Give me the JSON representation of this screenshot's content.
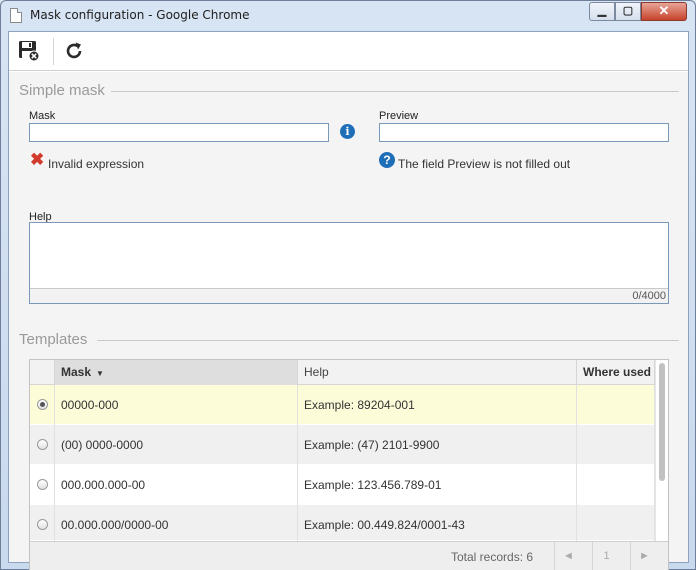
{
  "window": {
    "title": "Mask configuration - Google Chrome"
  },
  "icons": {
    "page": "page-icon",
    "save": "save-close-icon",
    "refresh": "refresh-icon",
    "info": "info-icon",
    "error": "x-icon",
    "help": "question-icon"
  },
  "colors": {
    "error": "#d23b2b",
    "info": "#1f6fb8",
    "selected_row": "#fdfcd9"
  },
  "simple_mask": {
    "section_title": "Simple mask",
    "mask_label": "Mask",
    "mask_value": "",
    "preview_label": "Preview",
    "preview_value": "",
    "error_text": "Invalid expression",
    "preview_status": "The field Preview is not filled out",
    "help_label": "Help",
    "help_value": "",
    "counter": "0/4000"
  },
  "templates": {
    "section_title": "Templates",
    "columns": {
      "mask": "Mask",
      "help": "Help",
      "where_used": "Where used"
    },
    "rows": [
      {
        "mask": "00000-000",
        "help": "Example: 89204-001",
        "where_used": "",
        "selected": true
      },
      {
        "mask": "(00) 0000-0000",
        "help": "Example: (47) 2101-9900",
        "where_used": "",
        "selected": false
      },
      {
        "mask": "000.000.000-00",
        "help": "Example: 123.456.789-01",
        "where_used": "",
        "selected": false
      },
      {
        "mask": "00.000.000/0000-00",
        "help": "Example: 00.449.824/0001-43",
        "where_used": "",
        "selected": false
      }
    ],
    "total": "Total records: 6",
    "pagination": {
      "prev": "◄",
      "page": "1",
      "next": "►"
    }
  }
}
